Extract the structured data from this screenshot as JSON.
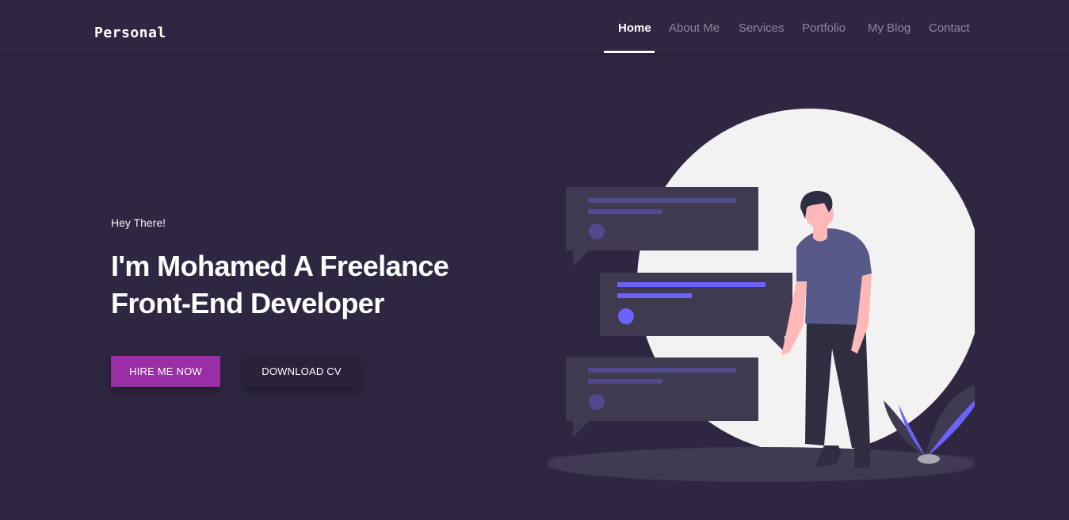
{
  "header": {
    "logo": "Personal",
    "nav": [
      {
        "label": "Home",
        "active": true
      },
      {
        "label": "About Me",
        "active": false
      },
      {
        "label": "Services",
        "active": false
      },
      {
        "label": "Portfolio",
        "active": false
      },
      {
        "label": "My Blog",
        "active": false
      },
      {
        "label": "Contact",
        "active": false
      }
    ]
  },
  "hero": {
    "greeting": "Hey There!",
    "title_line1": "I'm Mohamed A Freelance",
    "title_line2": "Front-End Developer",
    "hire_label": "HIRE ME NOW",
    "cv_label": "DOWNLOAD CV"
  },
  "colors": {
    "background": "#2f2742",
    "accent": "#9a2ea6",
    "illustration_purple": "#6c63ff"
  }
}
